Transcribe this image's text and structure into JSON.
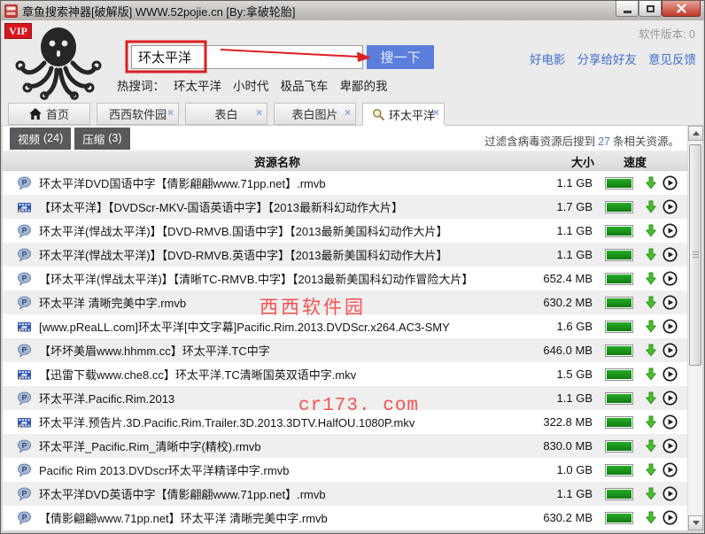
{
  "window": {
    "title": "章鱼搜索神器[破解版] WWW.52pojie.cn [By:拿破轮胎]"
  },
  "header": {
    "vip": "VIP",
    "search_value": "环太平洋",
    "search_button": "搜一下",
    "version": "软件版本: 0",
    "links": [
      "好电影",
      "分享给好友",
      "意见反馈"
    ],
    "hot_label": "热搜词：",
    "hot_words": [
      "环太平洋",
      "小时代",
      "极品飞车",
      "卑鄙的我"
    ]
  },
  "tabs": [
    {
      "label": "首页",
      "icon": "home",
      "closable": false,
      "active": false
    },
    {
      "label": "西西软件园",
      "icon": "none",
      "closable": true,
      "active": false
    },
    {
      "label": "表白",
      "icon": "none",
      "closable": true,
      "active": false
    },
    {
      "label": "表白图片",
      "icon": "none",
      "closable": true,
      "active": false
    },
    {
      "label": "环太平洋",
      "icon": "search",
      "closable": true,
      "active": true
    }
  ],
  "filters": [
    {
      "label": "视频",
      "count": "(24)"
    },
    {
      "label": "压缩",
      "count": "(3)"
    }
  ],
  "result_info": {
    "prefix": "过滤含病毒资源后搜到",
    "count": "27",
    "suffix": "条相关资源。"
  },
  "table": {
    "headers": {
      "name": "资源名称",
      "size": "大小",
      "speed": "速度"
    },
    "rows": [
      {
        "icon": "qvod",
        "name": "环太平洋DVD国语中字【倩影翩翩www.71pp.net】.rmvb",
        "size": "1.1 GB"
      },
      {
        "icon": "film",
        "name": "【环太平洋】【DVDScr-MKV-国语英语中字】【2013最新科幻动作大片】",
        "size": "1.7 GB"
      },
      {
        "icon": "qvod",
        "name": "环太平洋(悍战太平洋)】【DVD-RMVB.国语中字】【2013最新美国科幻动作大片】",
        "size": "1.1 GB"
      },
      {
        "icon": "qvod",
        "name": "环太平洋(悍战太平洋)】【DVD-RMVB.英语中字】【2013最新美国科幻动作大片】",
        "size": "1.1 GB"
      },
      {
        "icon": "qvod",
        "name": "【环太平洋(悍战太平洋)】【清晰TC-RMVB.中字】【2013最新美国科幻动作冒险大片】",
        "size": "652.4 MB"
      },
      {
        "icon": "qvod",
        "name": "环太平洋 清晰完美中字.rmvb",
        "size": "630.2 MB"
      },
      {
        "icon": "film",
        "name": "[www.pReaLL.com]环太平洋[中文字幕]Pacific.Rim.2013.DVDScr.x264.AC3-SMY",
        "size": "1.6 GB"
      },
      {
        "icon": "qvod",
        "name": "【坏坏美眉www.hhmm.cc】环太平洋.TC中字",
        "size": "646.0 MB"
      },
      {
        "icon": "film",
        "name": "【迅雷下载www.che8.cc】环太平洋.TC清晰国英双语中字.mkv",
        "size": "1.5 GB"
      },
      {
        "icon": "qvod",
        "name": "环太平洋.Pacific.Rim.2013",
        "size": "1.1 GB"
      },
      {
        "icon": "film",
        "name": "环太平洋.预告片.3D.Pacific.Rim.Trailer.3D.2013.3DTV.HalfOU.1080P.mkv",
        "size": "322.8 MB"
      },
      {
        "icon": "qvod",
        "name": "环太平洋_Pacific.Rim_清晰中字(精校).rmvb",
        "size": "830.0 MB"
      },
      {
        "icon": "qvod",
        "name": "Pacific Rim 2013.DVDscr环太平洋精译中字.rmvb",
        "size": "1.0 GB"
      },
      {
        "icon": "qvod",
        "name": "环太平洋DVD英语中字【倩影翩翩www.71pp.net】.rmvb",
        "size": "1.1 GB"
      },
      {
        "icon": "qvod",
        "name": "【倩影翩翩www.71pp.net】环太平洋  清晰完美中字.rmvb",
        "size": "630.2 MB"
      }
    ]
  },
  "watermarks": {
    "w1": "西西软件园",
    "w2": "cr173. com"
  },
  "colors": {
    "accent_blue": "#5b7edc",
    "link_blue": "#3e6fd0",
    "progress_green": "#1c9a1c",
    "annotation_red": "#dc1f1f",
    "watermark_red": "#fa5151",
    "vip_red": "#d8161d"
  }
}
